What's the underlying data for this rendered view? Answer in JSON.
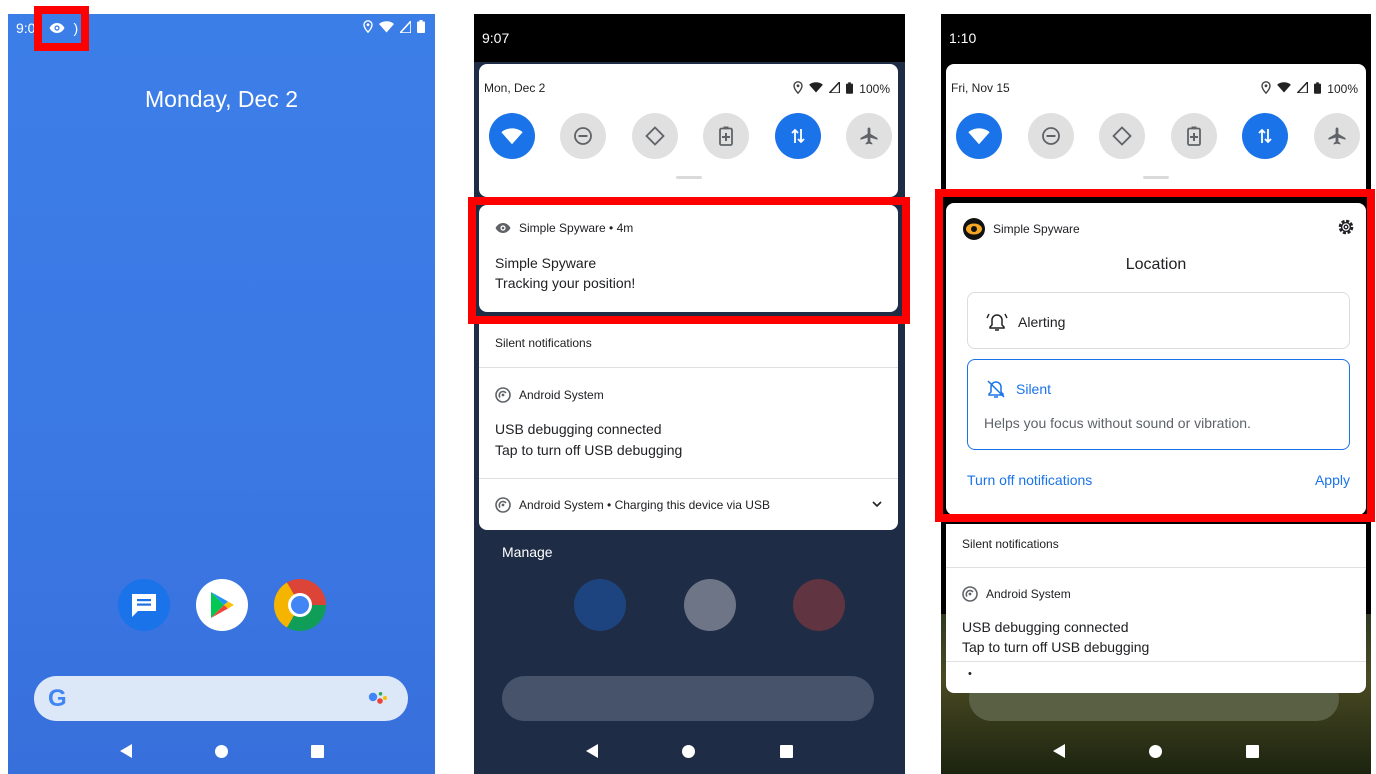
{
  "panel1": {
    "status_time": "9:0",
    "status_time_suffix": ")",
    "date": "Monday, Dec 2"
  },
  "panel2": {
    "status_time": "9:07",
    "qs_date": "Mon, Dec 2",
    "battery": "100%",
    "spyware_header": "Simple Spyware • 4m",
    "spyware_title": "Simple Spyware",
    "spyware_text": "Tracking your position!",
    "silent_header": "Silent notifications",
    "android_system": "Android System",
    "usb_title": "USB debugging connected",
    "usb_text": "Tap to turn off USB debugging",
    "charging": "Android System • Charging this device via USB",
    "manage": "Manage"
  },
  "panel3": {
    "status_time": "1:10",
    "qs_date": "Fri, Nov 15",
    "battery": "100%",
    "app_name": "Simple Spyware",
    "channel": "Location",
    "alerting": "Alerting",
    "silent": "Silent",
    "silent_desc": "Helps you focus without sound or vibration.",
    "turn_off": "Turn off notifications",
    "apply": "Apply",
    "silent_header": "Silent notifications",
    "android_system": "Android System",
    "usb_title": "USB debugging connected",
    "usb_text": "Tap to turn off USB debugging",
    "dot": "•"
  },
  "colors": {
    "highlight": "#ff0000",
    "accent": "#1a73e8",
    "tile_off": "#e0e0e0"
  },
  "icons": [
    "eye-icon",
    "location-icon",
    "wifi-icon",
    "signal-icon",
    "battery-icon",
    "dnd-icon",
    "auto-rotate-icon",
    "battery-saver-icon",
    "mobile-data-icon",
    "airplane-icon",
    "gear-icon",
    "bell-icon",
    "bell-off-icon",
    "android-system-icon",
    "chevron-down-icon",
    "google-g-icon",
    "assistant-icon"
  ]
}
